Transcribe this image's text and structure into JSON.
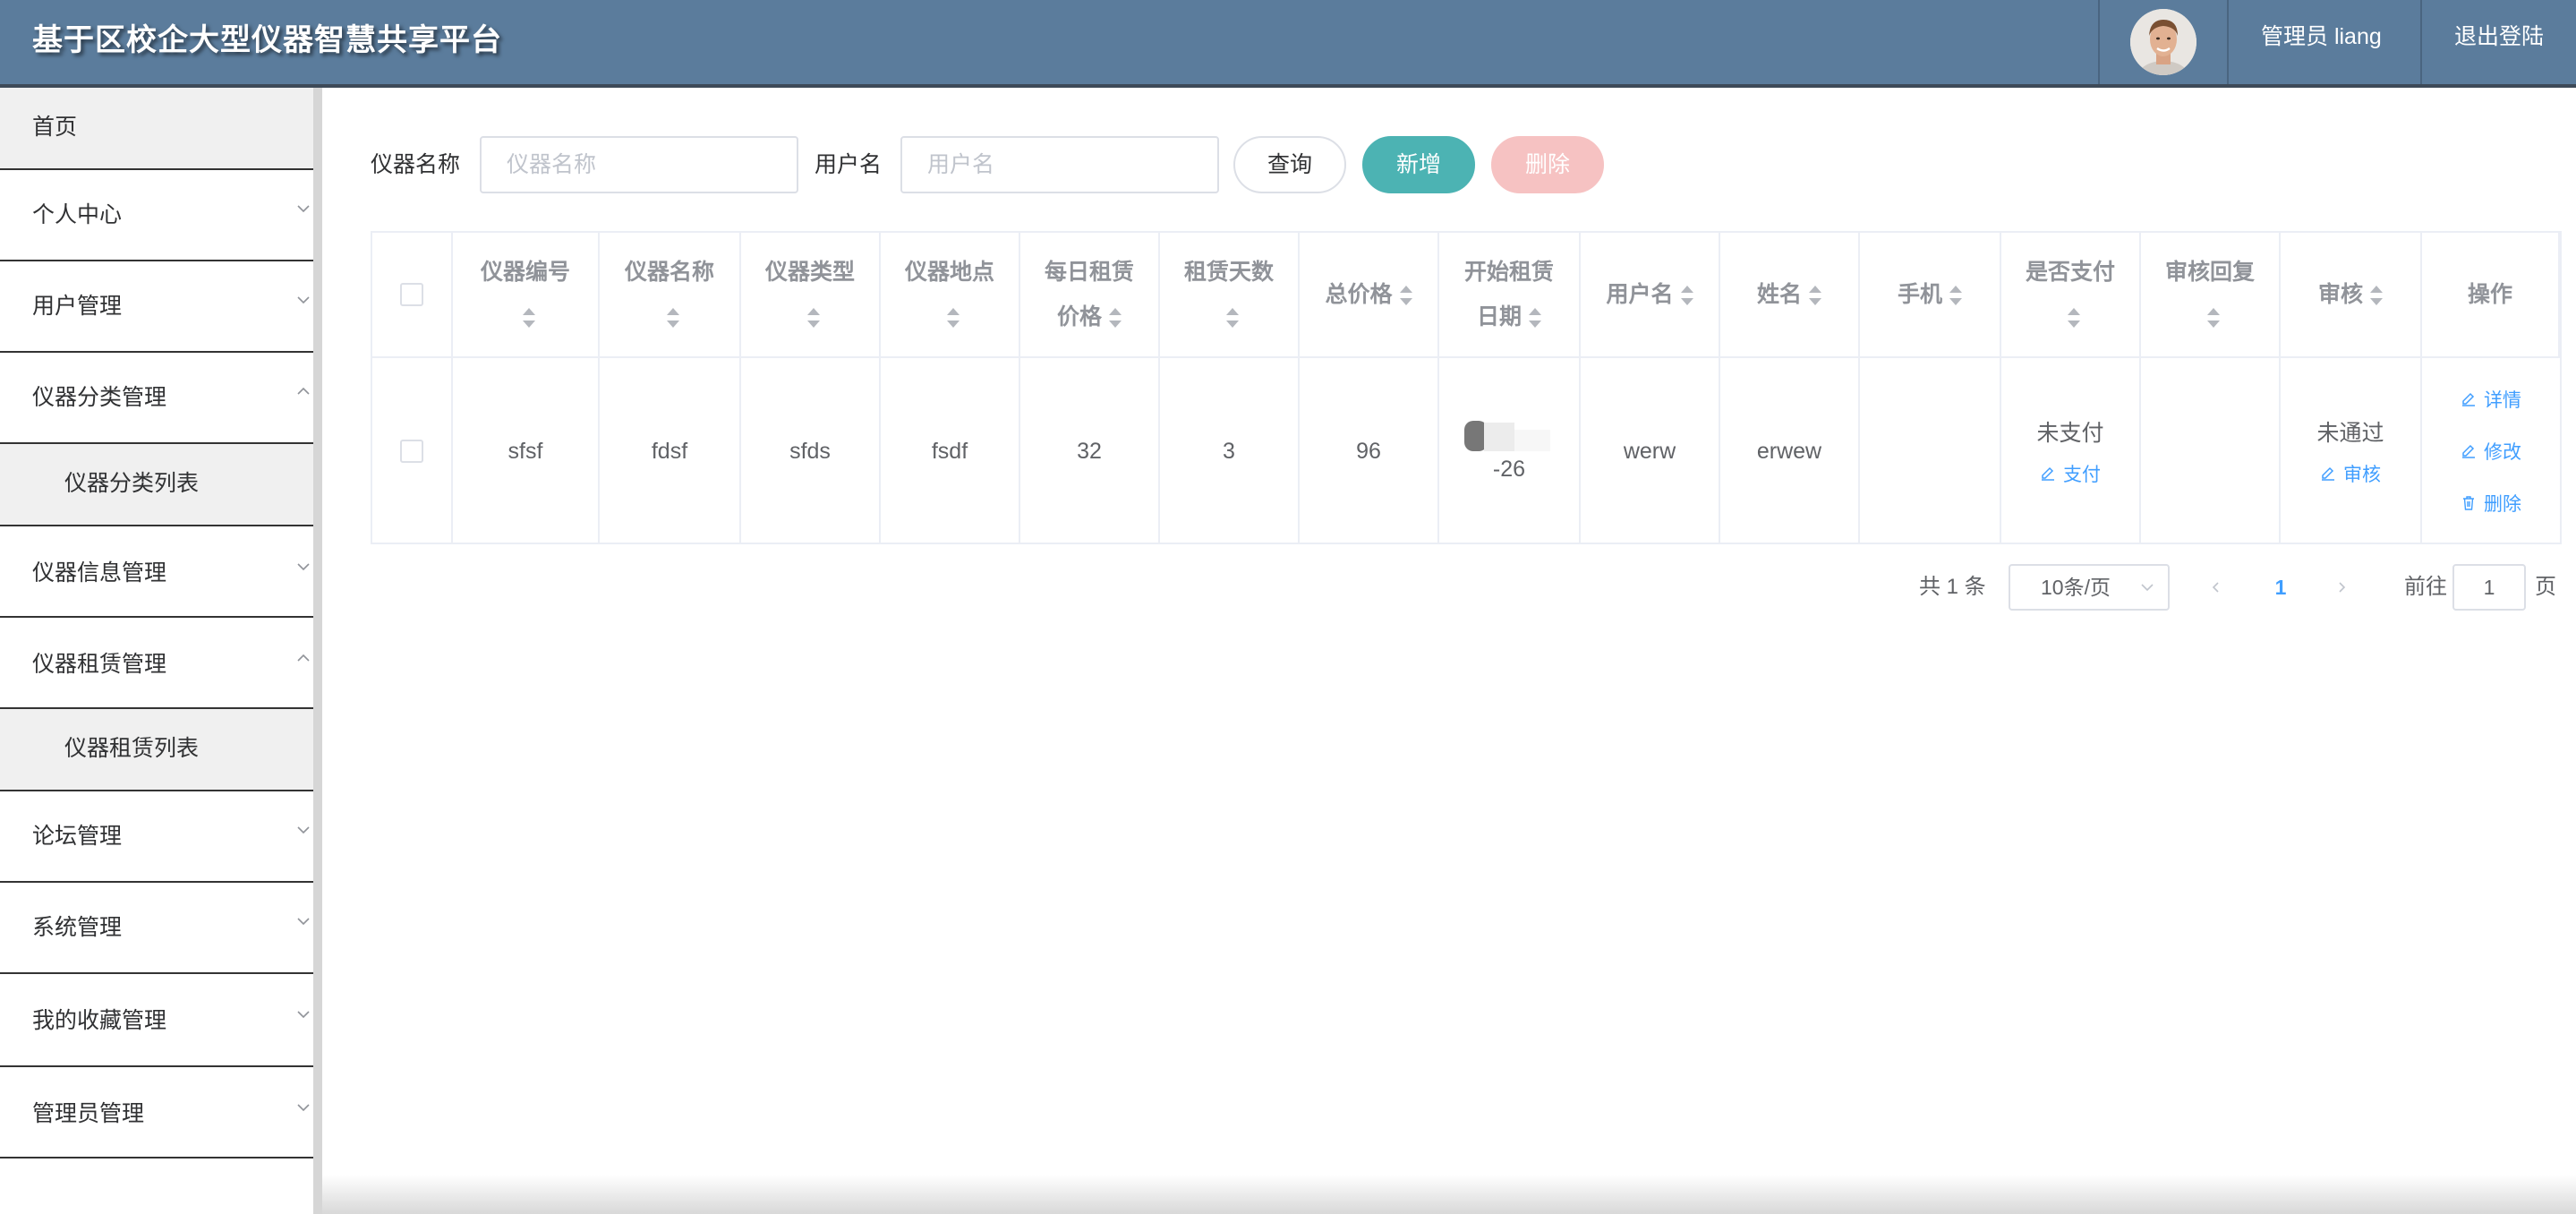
{
  "header": {
    "title": "基于区校企大型仪器智慧共享平台",
    "user_label": "管理员 liang",
    "logout_label": "退出登陆"
  },
  "sidebar": {
    "items": [
      {
        "label": "首页"
      },
      {
        "label": "个人中心"
      },
      {
        "label": "用户管理"
      },
      {
        "label": "仪器分类管理"
      },
      {
        "label": "仪器分类列表"
      },
      {
        "label": "仪器信息管理"
      },
      {
        "label": "仪器租赁管理"
      },
      {
        "label": "仪器租赁列表"
      },
      {
        "label": "论坛管理"
      },
      {
        "label": "系统管理"
      },
      {
        "label": "我的收藏管理"
      },
      {
        "label": "管理员管理"
      }
    ]
  },
  "search": {
    "name_label": "仪器名称",
    "name_placeholder": "仪器名称",
    "user_label": "用户名",
    "user_placeholder": "用户名",
    "query_label": "查询",
    "add_label": "新增",
    "delete_label": "删除"
  },
  "table": {
    "headers": {
      "code_l1": "仪器编号",
      "name_l1": "仪器名称",
      "type_l1": "仪器类型",
      "location_l1": "仪器地点",
      "daily_l1": "每日租赁",
      "daily_l2": "价格",
      "days_l1": "租赁天数",
      "total": "总价格",
      "start_l1": "开始租赁",
      "start_l2": "日期",
      "username": "用户名",
      "fullname": "姓名",
      "phone": "手机",
      "paid_l1": "是否支付",
      "reply_l1": "审核回复",
      "audit": "审核",
      "ops": "操作"
    },
    "row": {
      "code": "sfsf",
      "name": "fdsf",
      "type": "sfds",
      "location": "fsdf",
      "daily": "32",
      "days": "3",
      "total": "96",
      "start_date": "-26",
      "username": "werw",
      "fullname": "erwew",
      "phone": "",
      "paid_status": "未支付",
      "pay_label": "支付",
      "reply": "",
      "audit_status": "未通过",
      "audit_label": "审核",
      "detail_label": "详情",
      "edit_label": "修改",
      "delete_label": "删除"
    }
  },
  "pagination": {
    "total_text": "共 1 条",
    "page_size": "10条/页",
    "current_page": "1",
    "goto_label": "前往",
    "goto_value": "1",
    "page_suffix": "页"
  },
  "colors": {
    "header_bg": "#5b7c9c",
    "accent": "#4cb3b3",
    "danger_light": "#f6c2c2",
    "link": "#409eff"
  }
}
